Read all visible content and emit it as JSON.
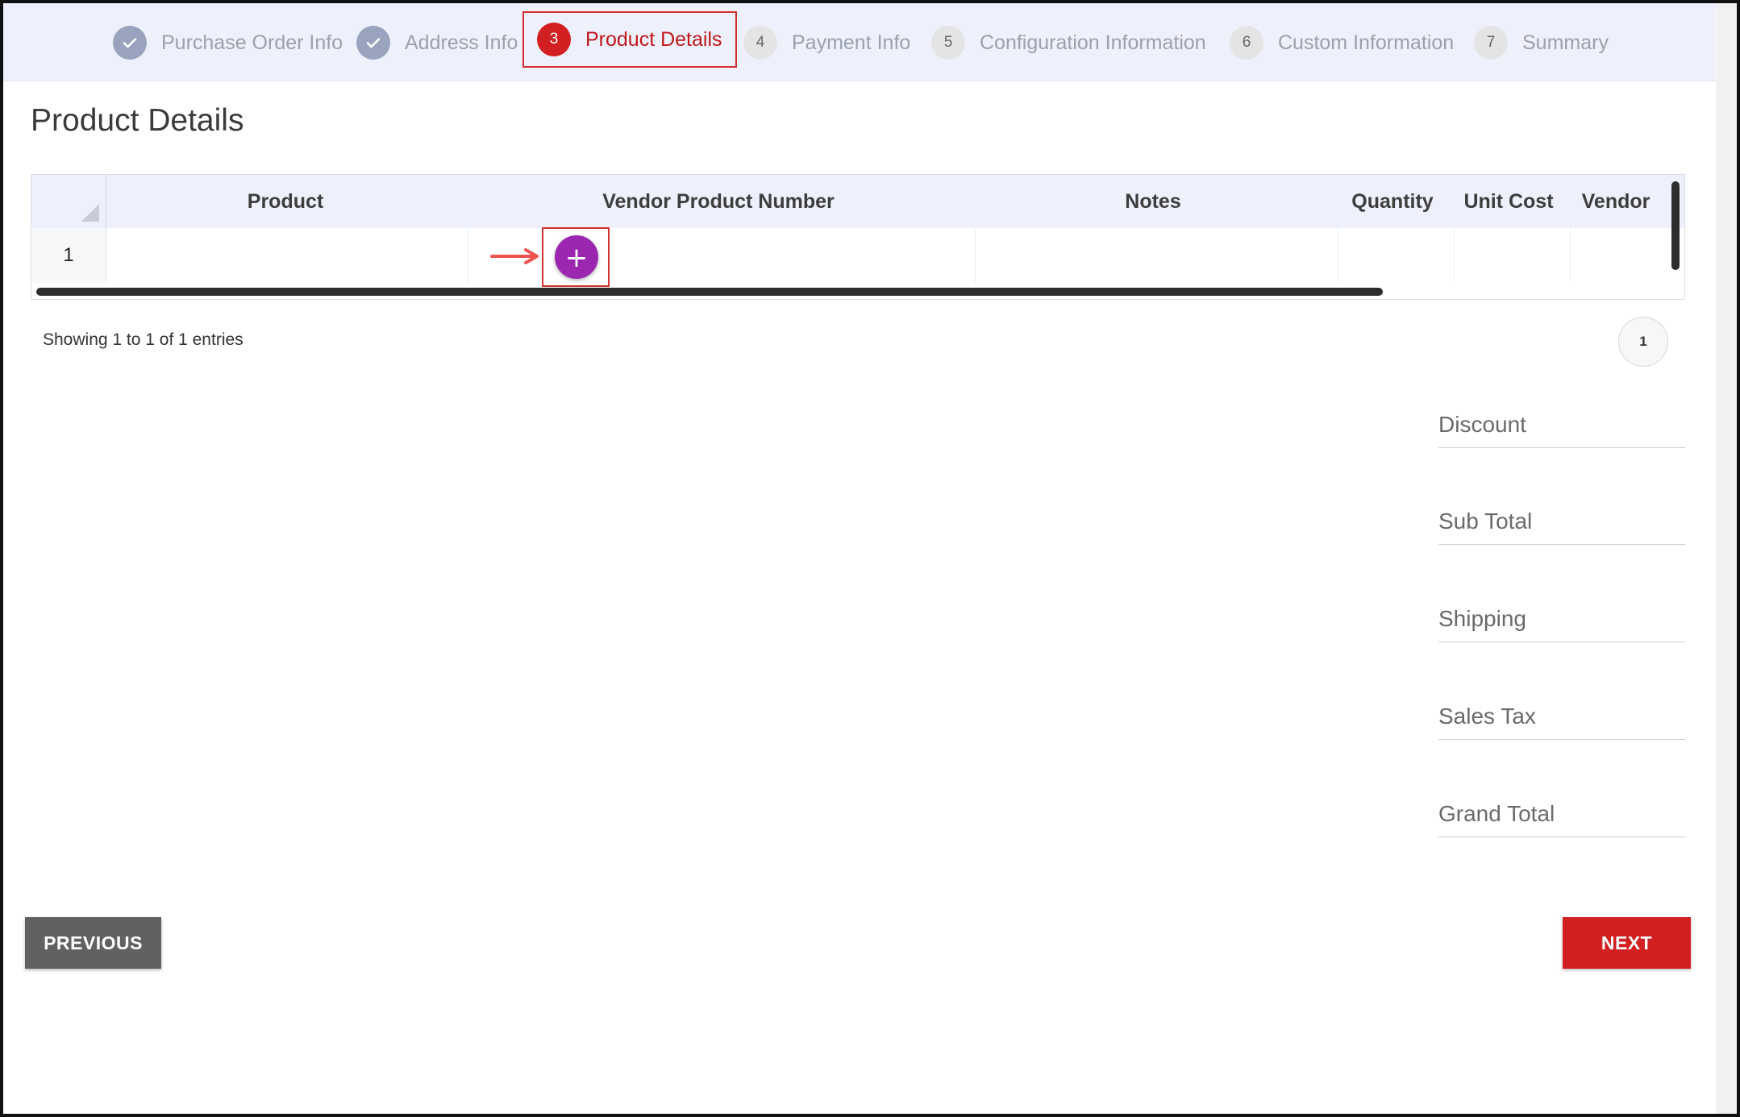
{
  "stepper": {
    "steps": [
      {
        "number": "",
        "label": "Purchase Order Info",
        "state": "done"
      },
      {
        "number": "",
        "label": "Address Info",
        "state": "done"
      },
      {
        "number": "3",
        "label": "Product Details",
        "state": "active"
      },
      {
        "number": "4",
        "label": "Payment Info",
        "state": "pending"
      },
      {
        "number": "5",
        "label": "Configuration Information",
        "state": "pending"
      },
      {
        "number": "6",
        "label": "Custom Information",
        "state": "pending"
      },
      {
        "number": "7",
        "label": "Summary",
        "state": "pending"
      }
    ]
  },
  "page": {
    "title": "Product Details"
  },
  "grid": {
    "columns": [
      "Product",
      "Vendor Product Number",
      "Notes",
      "Quantity",
      "Unit Cost",
      "Vendor"
    ],
    "rows": [
      {
        "row_number": "1"
      }
    ],
    "add_icon": "+"
  },
  "pagination": {
    "entries_text": "Showing 1 to 1 of 1 entries",
    "current_page": "1"
  },
  "totals": {
    "discount": "Discount",
    "sub_total": "Sub Total",
    "shipping": "Shipping",
    "sales_tax": "Sales Tax",
    "grand_total": "Grand Total"
  },
  "actions": {
    "previous": "PREVIOUS",
    "next": "NEXT"
  },
  "colors": {
    "accent": "#d21f21",
    "add_button": "#9b27b0",
    "header_bg": "#eef1fb"
  }
}
